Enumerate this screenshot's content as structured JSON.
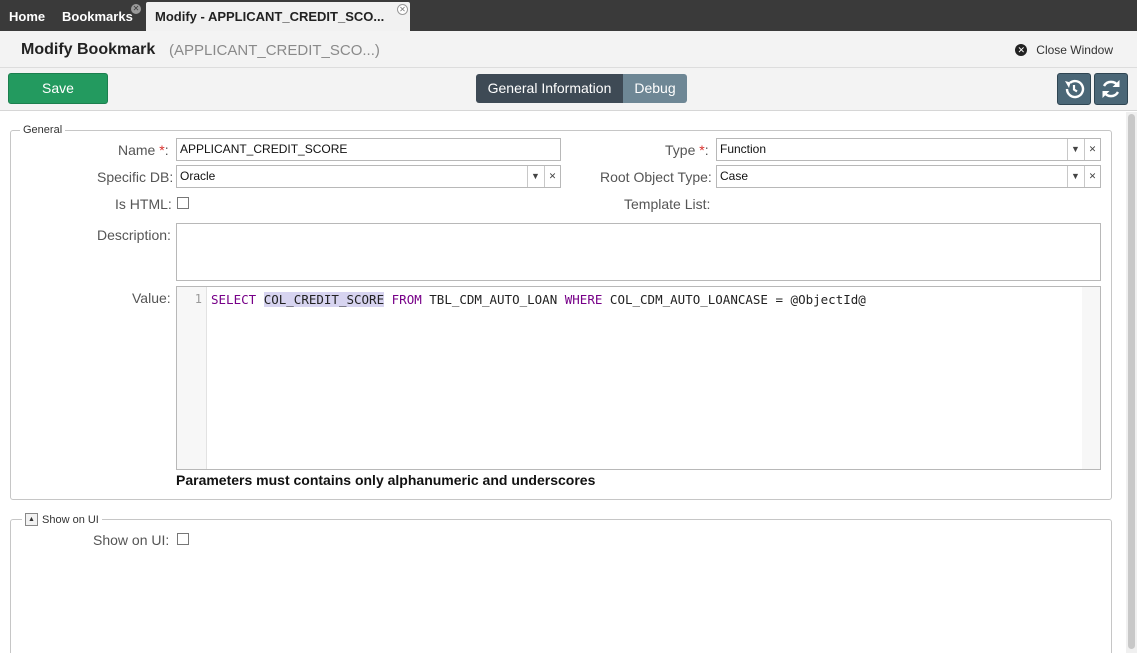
{
  "tabs": {
    "home": "Home",
    "bookmarks": "Bookmarks",
    "active": "Modify - APPLICANT_CREDIT_SCO..."
  },
  "header": {
    "title": "Modify Bookmark",
    "subtitle": "(APPLICANT_CREDIT_SCO...)",
    "close_label": "Close Window"
  },
  "toolbar": {
    "save_label": "Save",
    "general_tab": "General Information",
    "debug_tab": "Debug"
  },
  "general": {
    "legend": "General",
    "name_label": "Name",
    "name_value": "APPLICANT_CREDIT_SCORE",
    "type_label": "Type",
    "type_value": "Function",
    "specific_db_label": "Specific DB:",
    "specific_db_value": "Oracle",
    "root_object_label": "Root Object Type:",
    "root_object_value": "Case",
    "is_html_label": "Is HTML:",
    "template_list_label": "Template List:",
    "description_label": "Description:",
    "value_label": "Value:",
    "line_number": "1",
    "code": {
      "kw_select": "SELECT",
      "col": "COL_CREDIT_SCORE",
      "kw_from": "FROM",
      "table": "TBL_CDM_AUTO_LOAN",
      "kw_where": "WHERE",
      "condition": "COL_CDM_AUTO_LOANCASE = @ObjectId@"
    },
    "hint": "Parameters must contains only alphanumeric and underscores"
  },
  "show_on_ui": {
    "legend": "Show on UI",
    "label": "Show on UI:"
  },
  "colors": {
    "save": "#239a5f",
    "tab_active": "#3e4a55",
    "tab_inactive": "#6e8795",
    "icon_button": "#4b6777",
    "keyword": "#770088"
  }
}
